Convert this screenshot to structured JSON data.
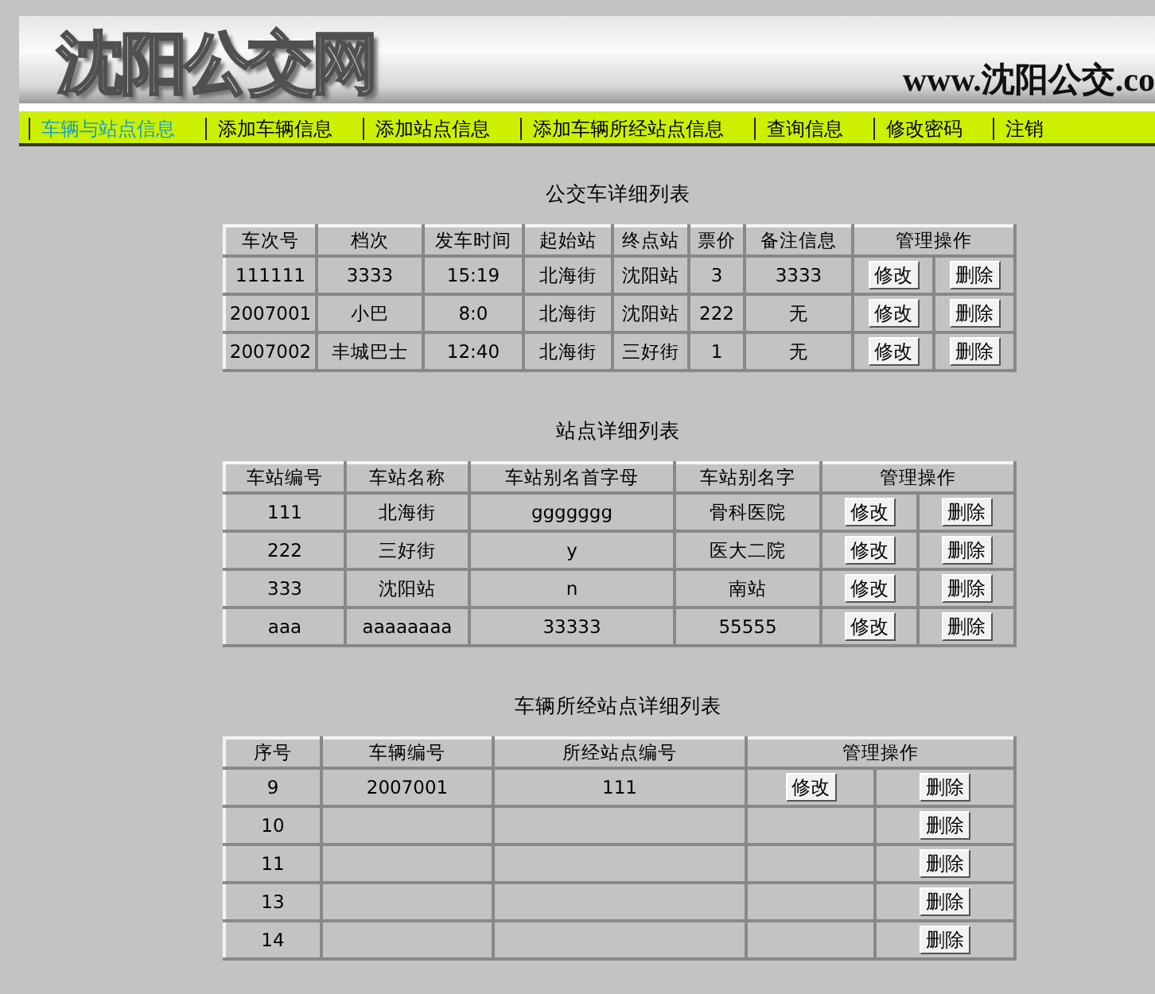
{
  "header": {
    "logo": "沈阳公交网",
    "url": "www.沈阳公交.co"
  },
  "nav": [
    {
      "label": "车辆与站点信息",
      "selected": true
    },
    {
      "label": "添加车辆信息",
      "selected": false
    },
    {
      "label": "添加站点信息",
      "selected": false
    },
    {
      "label": "添加车辆所经站点信息",
      "selected": false
    },
    {
      "label": "查询信息",
      "selected": false
    },
    {
      "label": "修改密码",
      "selected": false
    },
    {
      "label": "注销",
      "selected": false
    }
  ],
  "sections": [
    {
      "title": "公交车详细列表",
      "columns": [
        "车次号",
        "档次",
        "发车时间",
        "起始站",
        "终点站",
        "票价",
        "备注信息"
      ],
      "actions_header": "管理操作",
      "rows": [
        {
          "cells": [
            "111111",
            "3333",
            "15:19",
            "北海街",
            "沈阳站",
            "3",
            "3333"
          ],
          "edit": "修改",
          "delete": "删除"
        },
        {
          "cells": [
            "2007001",
            "小巴",
            "8:0",
            "北海街",
            "沈阳站",
            "222",
            "无"
          ],
          "edit": "修改",
          "delete": "删除"
        },
        {
          "cells": [
            "2007002",
            "丰城巴士",
            "12:40",
            "北海街",
            "三好街",
            "1",
            "无"
          ],
          "edit": "修改",
          "delete": "删除"
        }
      ]
    },
    {
      "title": "站点详细列表",
      "columns": [
        "车站编号",
        "车站名称",
        "车站别名首字母",
        "车站别名字"
      ],
      "actions_header": "管理操作",
      "rows": [
        {
          "cells": [
            "111",
            "北海街",
            "ggggggg",
            "骨科医院"
          ],
          "edit": "修改",
          "delete": "删除"
        },
        {
          "cells": [
            "222",
            "三好街",
            "y",
            "医大二院"
          ],
          "edit": "修改",
          "delete": "删除"
        },
        {
          "cells": [
            "333",
            "沈阳站",
            "n",
            "南站"
          ],
          "edit": "修改",
          "delete": "删除"
        },
        {
          "cells": [
            "aaa",
            "aaaaaaaa",
            "33333",
            "55555"
          ],
          "edit": "修改",
          "delete": "删除"
        }
      ]
    },
    {
      "title": "车辆所经站点详细列表",
      "columns": [
        "序号",
        "车辆编号",
        "所经站点编号"
      ],
      "actions_header": "管理操作",
      "rows": [
        {
          "cells": [
            "9",
            "2007001",
            "111"
          ],
          "edit": "修改",
          "delete": "删除"
        },
        {
          "cells": [
            "10"
          ],
          "delete": "删除"
        },
        {
          "cells": [
            "11"
          ],
          "delete": "删除"
        },
        {
          "cells": [
            "13"
          ],
          "delete": "删除"
        },
        {
          "cells": [
            "14"
          ],
          "delete": "删除"
        }
      ]
    }
  ]
}
